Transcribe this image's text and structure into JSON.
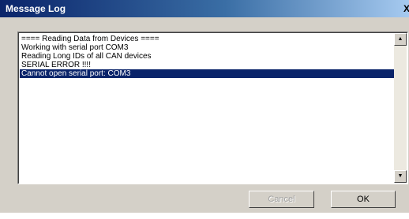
{
  "window": {
    "title": "Message Log",
    "close_glyph": "X"
  },
  "log": {
    "lines": [
      "==== Reading Data from Devices ====",
      "Working with serial port COM3",
      "Reading Long IDs of all CAN devices",
      "SERIAL ERROR !!!!",
      "Cannot open serial port: COM3"
    ],
    "selected_index": 4
  },
  "scrollbar": {
    "up_icon": "up-arrow-icon",
    "down_icon": "down-arrow-icon"
  },
  "buttons": {
    "cancel_label": "Cancel",
    "cancel_enabled": false,
    "ok_label": "OK"
  },
  "colors": {
    "selection": "#0a246a",
    "face": "#d4d0c8"
  }
}
